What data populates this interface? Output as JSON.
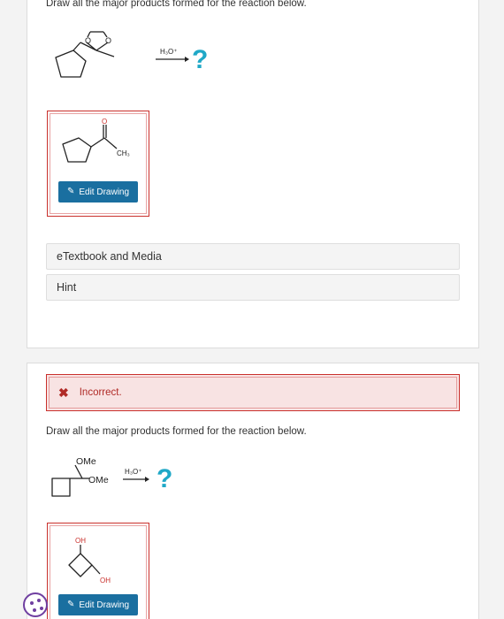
{
  "question1": {
    "prompt": "Draw all the major products formed for the reaction below.",
    "reagent": "H₃O⁺",
    "unknown": "?",
    "answer_label": "CH₃",
    "answer_oxygen": "O",
    "substrate_oxygen_1": "O",
    "substrate_oxygen_2": "O",
    "edit_button": "Edit Drawing"
  },
  "resources": {
    "etextbook": "eTextbook and Media",
    "hint": "Hint"
  },
  "question2": {
    "feedback": "Incorrect.",
    "prompt": "Draw all the major products formed for the reaction below.",
    "substituent_1": "OMe",
    "substituent_2": "OMe",
    "reagent": "H₃O⁺",
    "unknown": "?",
    "answer_oh_1": "OH",
    "answer_oh_2": "OH",
    "edit_button": "Edit Drawing"
  },
  "colors": {
    "accent_button": "#1a6fa0",
    "question_mark": "#1fa8c7",
    "error": "#c9302c",
    "cookie": "#6f3fa0"
  }
}
